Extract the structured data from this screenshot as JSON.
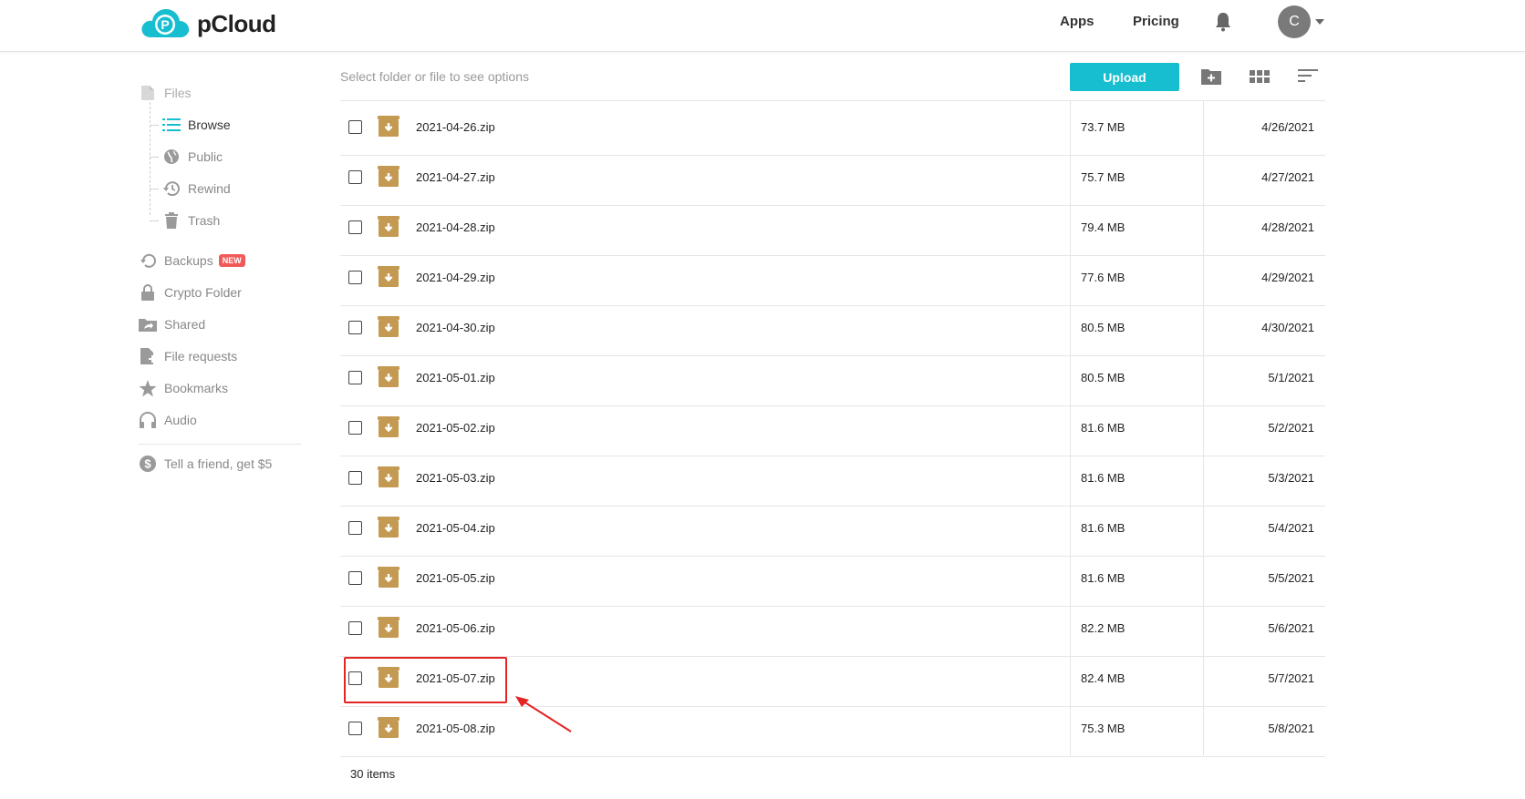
{
  "header": {
    "brand": "pCloud",
    "nav": [
      {
        "label": "Apps"
      },
      {
        "label": "Pricing"
      }
    ],
    "avatar_initial": "C"
  },
  "sidebar": {
    "files_label": "Files",
    "sub_items": [
      {
        "label": "Browse",
        "icon": "list-icon",
        "active": true
      },
      {
        "label": "Public",
        "icon": "globe-icon"
      },
      {
        "label": "Rewind",
        "icon": "rewind-icon"
      },
      {
        "label": "Trash",
        "icon": "trash-icon"
      }
    ],
    "items": [
      {
        "label": "Backups",
        "icon": "backup-icon",
        "badge": "NEW"
      },
      {
        "label": "Crypto Folder",
        "icon": "lock-icon"
      },
      {
        "label": "Shared",
        "icon": "shared-folder-icon"
      },
      {
        "label": "File requests",
        "icon": "file-request-icon"
      },
      {
        "label": "Bookmarks",
        "icon": "star-icon"
      },
      {
        "label": "Audio",
        "icon": "headphones-icon"
      }
    ],
    "referral_label": "Tell a friend, get $5"
  },
  "toolbar": {
    "hint": "Select folder or file to see options",
    "upload_label": "Upload"
  },
  "files": [
    {
      "name": "2021-04-26.zip",
      "size": "73.7 MB",
      "date": "4/26/2021"
    },
    {
      "name": "2021-04-27.zip",
      "size": "75.7 MB",
      "date": "4/27/2021"
    },
    {
      "name": "2021-04-28.zip",
      "size": "79.4 MB",
      "date": "4/28/2021"
    },
    {
      "name": "2021-04-29.zip",
      "size": "77.6 MB",
      "date": "4/29/2021"
    },
    {
      "name": "2021-04-30.zip",
      "size": "80.5 MB",
      "date": "4/30/2021"
    },
    {
      "name": "2021-05-01.zip",
      "size": "80.5 MB",
      "date": "5/1/2021"
    },
    {
      "name": "2021-05-02.zip",
      "size": "81.6 MB",
      "date": "5/2/2021"
    },
    {
      "name": "2021-05-03.zip",
      "size": "81.6 MB",
      "date": "5/3/2021"
    },
    {
      "name": "2021-05-04.zip",
      "size": "81.6 MB",
      "date": "5/4/2021"
    },
    {
      "name": "2021-05-05.zip",
      "size": "81.6 MB",
      "date": "5/5/2021"
    },
    {
      "name": "2021-05-06.zip",
      "size": "82.2 MB",
      "date": "5/6/2021"
    },
    {
      "name": "2021-05-07.zip",
      "size": "82.4 MB",
      "date": "5/7/2021"
    },
    {
      "name": "2021-05-08.zip",
      "size": "75.3 MB",
      "date": "5/8/2021"
    }
  ],
  "items_count": "30 items",
  "colors": {
    "accent": "#17bed0",
    "archive_icon": "#c49a52",
    "annotation": "#e52424",
    "new_badge": "#f25a5a"
  }
}
